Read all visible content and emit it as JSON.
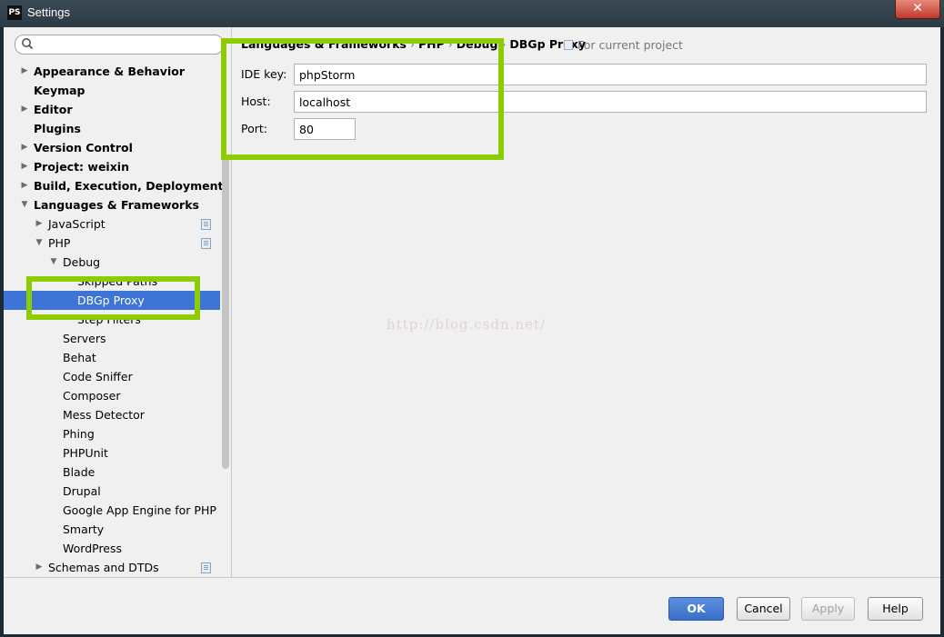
{
  "window": {
    "app_icon": "PS",
    "title": "Settings",
    "close_glyph": "✕"
  },
  "search": {
    "placeholder": ""
  },
  "tree": [
    {
      "label": "Appearance & Behavior",
      "bold": true,
      "arrow": "right",
      "indent": 0
    },
    {
      "label": "Keymap",
      "bold": true,
      "arrow": "none",
      "indent": 0
    },
    {
      "label": "Editor",
      "bold": true,
      "arrow": "right",
      "indent": 0
    },
    {
      "label": "Plugins",
      "bold": true,
      "arrow": "none",
      "indent": 0
    },
    {
      "label": "Version Control",
      "bold": true,
      "arrow": "right",
      "indent": 0
    },
    {
      "label": "Project: weixin",
      "bold": true,
      "arrow": "right",
      "indent": 0
    },
    {
      "label": "Build, Execution, Deployment",
      "bold": true,
      "arrow": "right",
      "indent": 0
    },
    {
      "label": "Languages & Frameworks",
      "bold": true,
      "arrow": "down",
      "indent": 0
    },
    {
      "label": "JavaScript",
      "bold": false,
      "arrow": "right",
      "indent": 1,
      "project_icon": true
    },
    {
      "label": "PHP",
      "bold": false,
      "arrow": "down",
      "indent": 1,
      "project_icon": true
    },
    {
      "label": "Debug",
      "bold": false,
      "arrow": "down",
      "indent": 2
    },
    {
      "label": "Skipped Paths",
      "bold": false,
      "arrow": "none",
      "indent": 3
    },
    {
      "label": "DBGp Proxy",
      "bold": false,
      "arrow": "none",
      "indent": 3,
      "selected": true
    },
    {
      "label": "Step Filters",
      "bold": false,
      "arrow": "none",
      "indent": 3
    },
    {
      "label": "Servers",
      "bold": false,
      "arrow": "none",
      "indent": 2
    },
    {
      "label": "Behat",
      "bold": false,
      "arrow": "none",
      "indent": 2
    },
    {
      "label": "Code Sniffer",
      "bold": false,
      "arrow": "none",
      "indent": 2
    },
    {
      "label": "Composer",
      "bold": false,
      "arrow": "none",
      "indent": 2
    },
    {
      "label": "Mess Detector",
      "bold": false,
      "arrow": "none",
      "indent": 2
    },
    {
      "label": "Phing",
      "bold": false,
      "arrow": "none",
      "indent": 2
    },
    {
      "label": "PHPUnit",
      "bold": false,
      "arrow": "none",
      "indent": 2
    },
    {
      "label": "Blade",
      "bold": false,
      "arrow": "none",
      "indent": 2
    },
    {
      "label": "Drupal",
      "bold": false,
      "arrow": "none",
      "indent": 2
    },
    {
      "label": "Google App Engine for PHP",
      "bold": false,
      "arrow": "none",
      "indent": 2
    },
    {
      "label": "Smarty",
      "bold": false,
      "arrow": "none",
      "indent": 2
    },
    {
      "label": "WordPress",
      "bold": false,
      "arrow": "none",
      "indent": 2
    },
    {
      "label": "Schemas and DTDs",
      "bold": false,
      "arrow": "right",
      "indent": 1,
      "project_icon": true
    }
  ],
  "breadcrumb": [
    "Languages & Frameworks",
    "PHP",
    "Debug",
    "DBGp Proxy"
  ],
  "breadcrumb_separator": "›",
  "scope_note": "For current project",
  "form": {
    "ide_key": {
      "label": "IDE key:",
      "value": "phpStorm"
    },
    "host": {
      "label": "Host:",
      "value": "localhost"
    },
    "port": {
      "label": "Port:",
      "value": "80"
    }
  },
  "watermark": "http://blog.csdn.net/",
  "footer": {
    "ok": "OK",
    "cancel": "Cancel",
    "apply": "Apply",
    "help": "Help"
  },
  "colors": {
    "selection": "#3d74d6",
    "highlight": "#8ccc00",
    "ok_button": "#3a6fc8"
  }
}
